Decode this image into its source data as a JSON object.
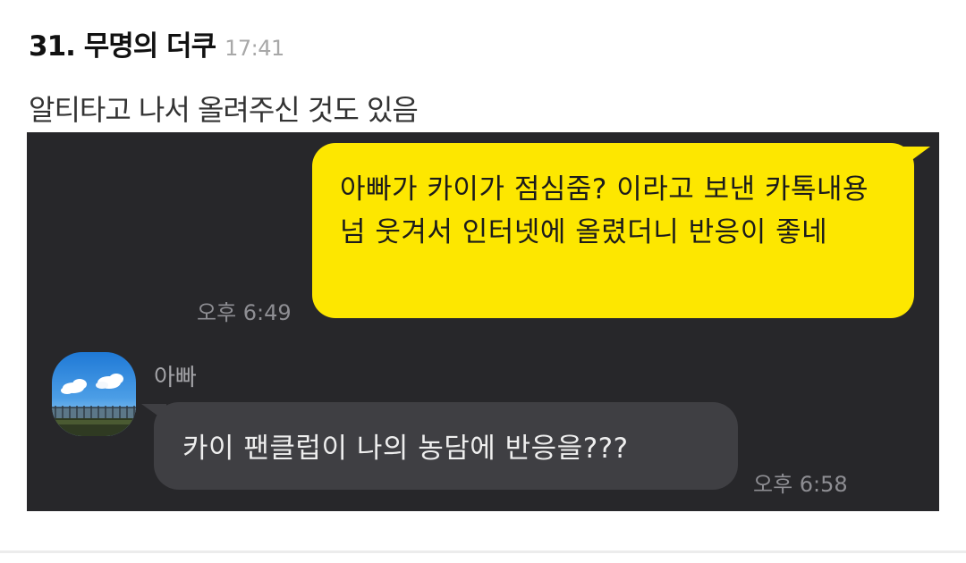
{
  "comment": {
    "author": "31. 무명의 더쿠",
    "time": "17:41",
    "text": "알티타고 나서 올려주신 것도 있음"
  },
  "chat": {
    "background_color": "#27272a",
    "sent_message": {
      "text": "아빠가 카이가 점심줌? 이라고 보낸 카톡내용 넘 웃겨서 인터넷에 올렸더니 반응이 좋네",
      "time": "오후 6:49",
      "bubble_color": "#fde700"
    },
    "received_message": {
      "sender": "아빠",
      "text": "카이 팬클럽이 나의 농담에 반응을???",
      "time": "오후 6:58",
      "bubble_color": "#3f3f43",
      "avatar_icon": "sky-landscape-avatar-icon"
    }
  }
}
